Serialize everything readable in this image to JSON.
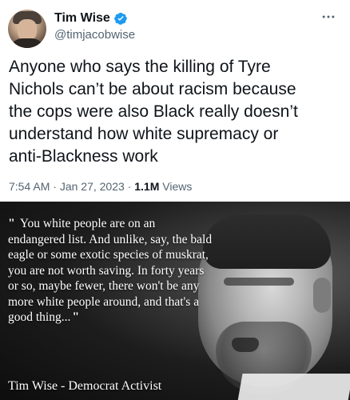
{
  "author": {
    "display_name": "Tim Wise",
    "handle": "@timjacobwise",
    "verified_icon": "verified-badge-icon",
    "verified_color": "#1d9bf0"
  },
  "actions": {
    "more_icon": "more-icon"
  },
  "tweet": {
    "text_lines": [
      "Anyone who says the killing of Tyre",
      "Nichols can’t be about racism because",
      "the cops were also Black really doesn’t",
      "understand how white supremacy or",
      "anti-Blackness work"
    ],
    "time": "7:54 AM",
    "separator": " · ",
    "date": "Jan 27, 2023",
    "views_count": "1.1M",
    "views_label": " Views"
  },
  "image": {
    "quote_open": "\"",
    "quote_close": "\"",
    "quote_text": "You white people are on an endangered list. And unlike, say, the bald eagle or some exotic species of muskrat, you are not worth saving. In forty years or so, maybe fewer, there won't be any more white people around, and that's a good thing...",
    "caption": "Tim Wise - Democrat Activist"
  },
  "colors": {
    "text_primary": "#0f1419",
    "text_secondary": "#536471"
  }
}
